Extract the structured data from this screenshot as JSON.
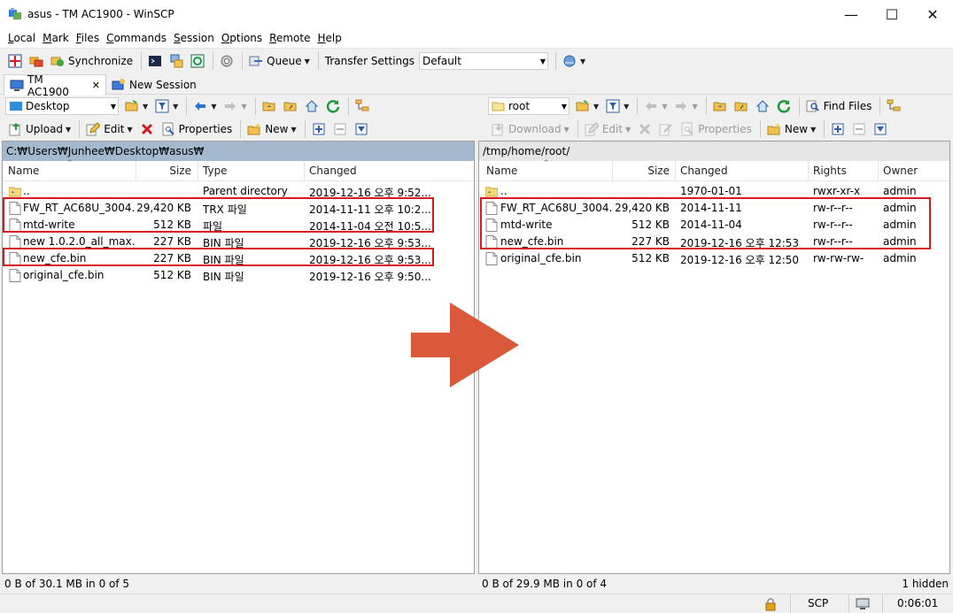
{
  "window": {
    "title": "asus - TM AC1900 - WinSCP",
    "controls": {
      "minimize": "—",
      "maximize": "☐",
      "close": "✕"
    }
  },
  "menu": [
    "Local",
    "Mark",
    "Files",
    "Commands",
    "Session",
    "Options",
    "Remote",
    "Help"
  ],
  "toolbar": {
    "synchronize": "Synchronize",
    "queue": "Queue",
    "transfer_settings_label": "Transfer Settings",
    "transfer_settings_value": "Default"
  },
  "tabs": {
    "active": "TM AC1900",
    "new_session": "New Session"
  },
  "left": {
    "location": "Desktop",
    "actions": {
      "upload": "Upload",
      "edit": "Edit",
      "properties": "Properties",
      "new": "New"
    },
    "path": "C:₩Users₩Junhee₩Desktop₩asus₩",
    "columns": [
      "Name",
      "Size",
      "Type",
      "Changed"
    ],
    "files": [
      {
        "name": "..",
        "size": "",
        "type": "Parent directory",
        "changed": "2019-12-16  오후 9:52...",
        "folder": true
      },
      {
        "name": "FW_RT_AC68U_3004...",
        "size": "29,420 KB",
        "type": "TRX 파일",
        "changed": "2014-11-11  오후 10:2..."
      },
      {
        "name": "mtd-write",
        "size": "512 KB",
        "type": "파일",
        "changed": "2014-11-04  오전 10:5..."
      },
      {
        "name": "new 1.0.2.0_all_max...",
        "size": "227 KB",
        "type": "BIN 파일",
        "changed": "2019-12-16  오후 9:53..."
      },
      {
        "name": "new_cfe.bin",
        "size": "227 KB",
        "type": "BIN 파일",
        "changed": "2019-12-16  오후 9:53..."
      },
      {
        "name": "original_cfe.bin",
        "size": "512 KB",
        "type": "BIN 파일",
        "changed": "2019-12-16  오후 9:50..."
      }
    ],
    "status": "0 B of 30.1 MB in 0 of 5"
  },
  "right": {
    "location": "root",
    "find_files": "Find Files",
    "actions": {
      "download": "Download",
      "edit": "Edit",
      "properties": "Properties",
      "new": "New"
    },
    "path": "/tmp/home/root/",
    "columns": [
      "Name",
      "Size",
      "Changed",
      "Rights",
      "Owner"
    ],
    "files": [
      {
        "name": "..",
        "size": "",
        "changed": "1970-01-01",
        "rights": "rwxr-xr-x",
        "owner": "admin",
        "folder": true
      },
      {
        "name": "FW_RT_AC68U_3004...",
        "size": "29,420 KB",
        "changed": "2014-11-11",
        "rights": "rw-r--r--",
        "owner": "admin"
      },
      {
        "name": "mtd-write",
        "size": "512 KB",
        "changed": "2014-11-04",
        "rights": "rw-r--r--",
        "owner": "admin"
      },
      {
        "name": "new_cfe.bin",
        "size": "227 KB",
        "changed": "2019-12-16  오후 12:53",
        "rights": "rw-r--r--",
        "owner": "admin"
      },
      {
        "name": "original_cfe.bin",
        "size": "512 KB",
        "changed": "2019-12-16  오후 12:50",
        "rights": "rw-rw-rw-",
        "owner": "admin"
      }
    ],
    "status": "0 B of 29.9 MB in 0 of 4",
    "hidden": "1 hidden"
  },
  "bottom": {
    "protocol": "SCP",
    "elapsed": "0:06:01"
  },
  "colors": {
    "highlight": "#d7191f",
    "arrow": "#d9593a",
    "left_path_bg": "#a4b9cd"
  }
}
